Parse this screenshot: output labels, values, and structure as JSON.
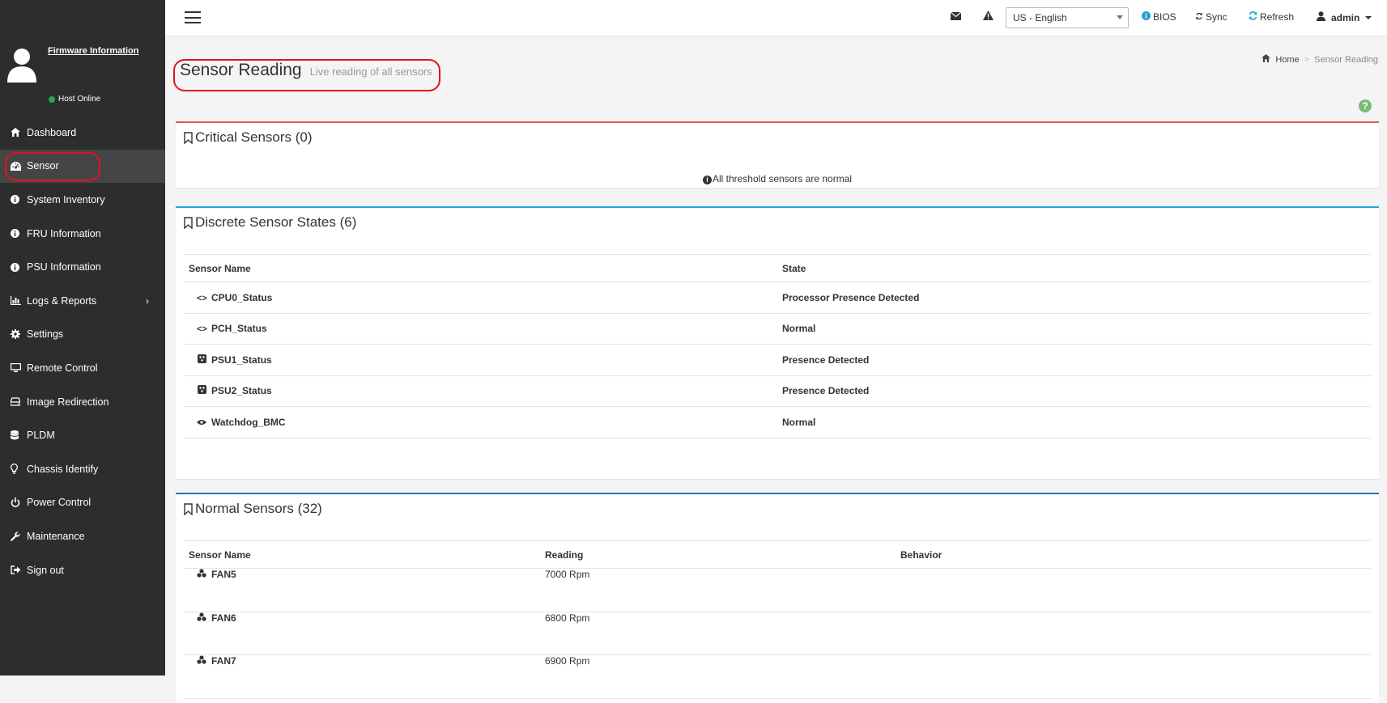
{
  "sidebar": {
    "firmware_link": "Firmware Information",
    "host_status": "Host Online",
    "items": [
      {
        "label": "Dashboard",
        "icon": "home-icon"
      },
      {
        "label": "Sensor",
        "icon": "dashboard-gauge-icon"
      },
      {
        "label": "System Inventory",
        "icon": "info-icon"
      },
      {
        "label": "FRU Information",
        "icon": "info-icon"
      },
      {
        "label": "PSU Information",
        "icon": "info-icon"
      },
      {
        "label": "Logs & Reports",
        "icon": "bar-chart-icon"
      },
      {
        "label": "Settings",
        "icon": "gear-icon"
      },
      {
        "label": "Remote Control",
        "icon": "monitor-icon"
      },
      {
        "label": "Image Redirection",
        "icon": "hdd-icon"
      },
      {
        "label": "PLDM",
        "icon": "database-icon"
      },
      {
        "label": "Chassis Identify",
        "icon": "lightbulb-icon"
      },
      {
        "label": "Power Control",
        "icon": "power-icon"
      },
      {
        "label": "Maintenance",
        "icon": "wrench-icon"
      },
      {
        "label": "Sign out",
        "icon": "sign-out-icon"
      }
    ]
  },
  "topbar": {
    "language": "US - English",
    "bios": "BIOS",
    "sync": "Sync",
    "refresh": "Refresh",
    "user": "admin"
  },
  "page": {
    "title": "Sensor Reading",
    "subtitle": "Live reading of all sensors",
    "breadcrumb_home": "Home",
    "breadcrumb_current": "Sensor Reading"
  },
  "critical": {
    "title": "Critical Sensors (0)",
    "message": "All threshold sensors are normal"
  },
  "discrete": {
    "title": "Discrete Sensor States (6)",
    "col_name": "Sensor Name",
    "col_state": "State",
    "rows": [
      {
        "name": "CPU0_Status",
        "state": "Processor Presence Detected"
      },
      {
        "name": "PCH_Status",
        "state": "Normal"
      },
      {
        "name": "PSU1_Status",
        "state": "Presence Detected"
      },
      {
        "name": "PSU2_Status",
        "state": "Presence Detected"
      },
      {
        "name": "Watchdog_BMC",
        "state": "Normal"
      }
    ]
  },
  "normal": {
    "title": "Normal Sensors (32)",
    "col_name": "Sensor Name",
    "col_reading": "Reading",
    "col_behavior": "Behavior",
    "rows": [
      {
        "name": "FAN5",
        "reading": "7000 Rpm"
      },
      {
        "name": "FAN6",
        "reading": "6800 Rpm"
      },
      {
        "name": "FAN7",
        "reading": "6900 Rpm"
      }
    ]
  }
}
